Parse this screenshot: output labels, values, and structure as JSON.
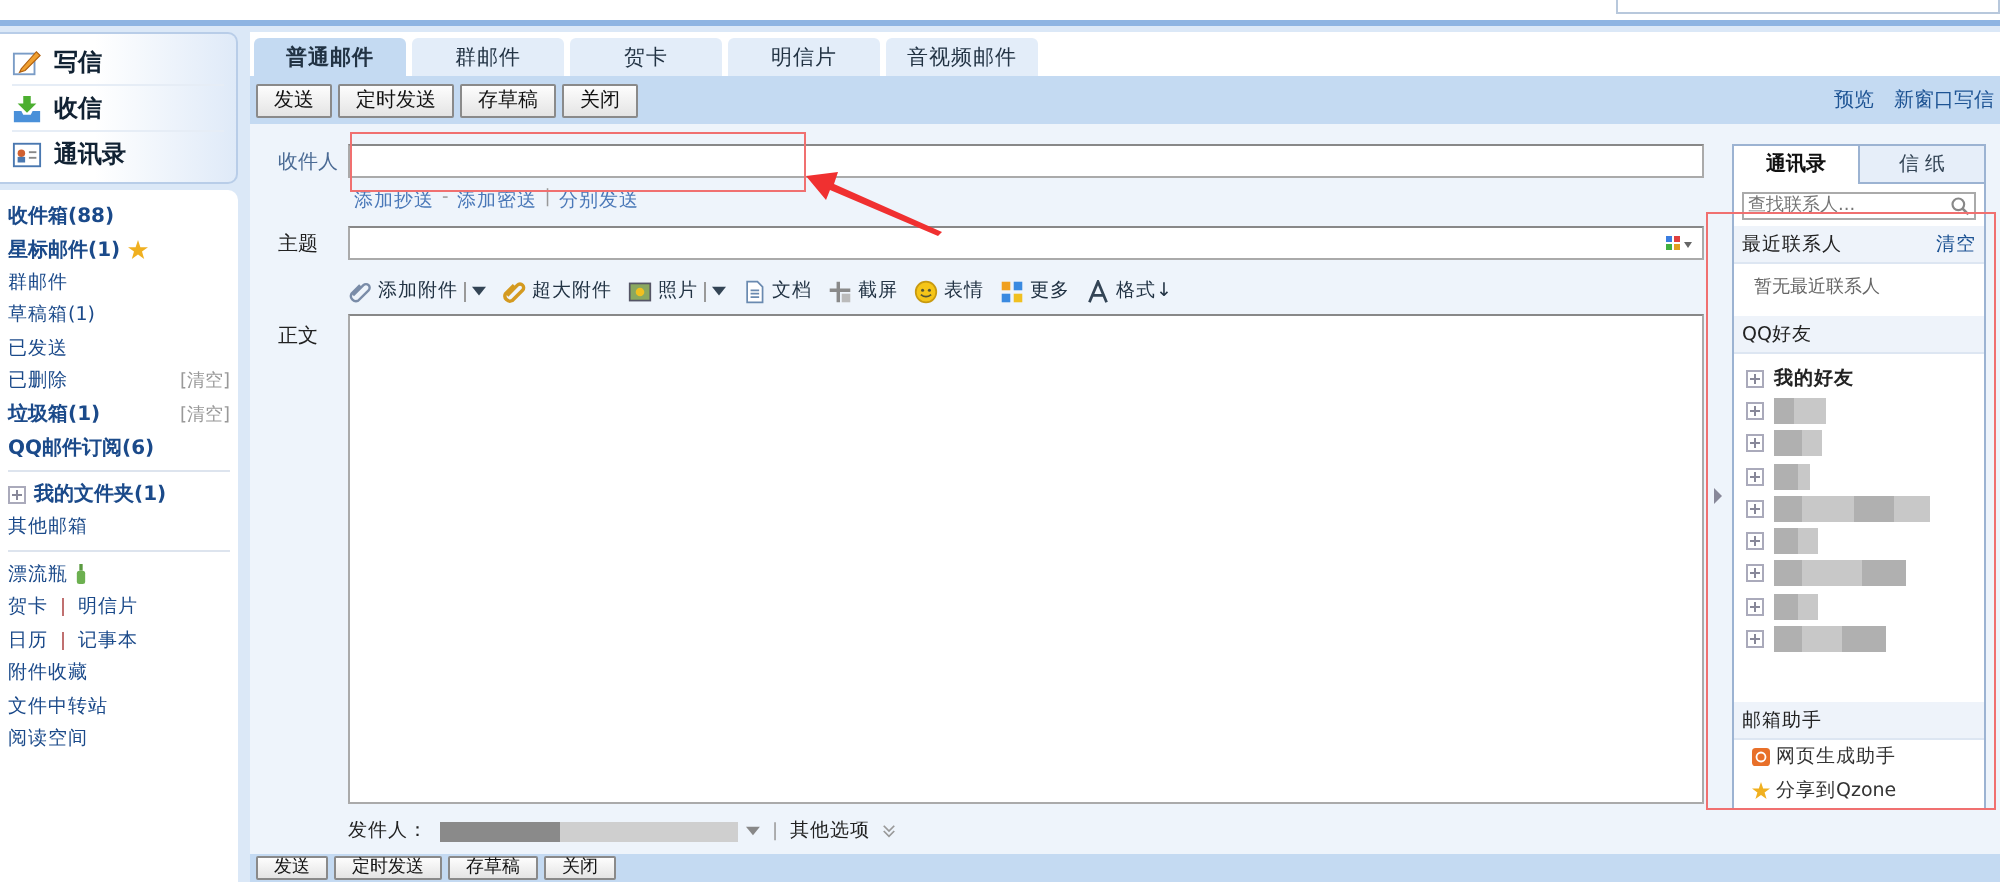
{
  "sidebar": {
    "actions": [
      {
        "kind": "write",
        "label": "写信"
      },
      {
        "kind": "receive",
        "label": "收信"
      },
      {
        "kind": "contacts",
        "label": "通讯录"
      }
    ],
    "groups": [
      [
        {
          "label": "收件箱(88)",
          "bold": true,
          "starred": false
        },
        {
          "label": "星标邮件(1)",
          "bold": true,
          "starred": true
        },
        {
          "label": "群邮件",
          "bold": false,
          "starred": false
        },
        {
          "label": "草稿箱(1)",
          "bold": false,
          "starred": false
        },
        {
          "label": "已发送",
          "bold": false,
          "starred": false
        },
        {
          "label": "已删除",
          "bold": false,
          "starred": false,
          "action": "[清空]"
        },
        {
          "label": "垃圾箱(1)",
          "bold": true,
          "starred": false,
          "action": "[清空]"
        },
        {
          "label": "QQ邮件订阅(6)",
          "bold": true,
          "starred": false
        }
      ],
      [
        {
          "label": "我的文件夹(1)",
          "bold": true,
          "starred": false,
          "expandable": true
        },
        {
          "label": "其他邮箱",
          "bold": false,
          "starred": false
        }
      ]
    ],
    "apps": [
      [
        {
          "label": "漂流瓶",
          "bottle": true
        }
      ],
      [
        {
          "label": "贺卡"
        },
        {
          "label": "明信片"
        }
      ],
      [
        {
          "label": "日历"
        },
        {
          "label": "记事本"
        }
      ],
      [
        {
          "label": "附件收藏"
        }
      ],
      [
        {
          "label": "文件中转站"
        }
      ],
      [
        {
          "label": "阅读空间"
        }
      ]
    ]
  },
  "tabs": [
    {
      "label": "普通邮件",
      "selected": true
    },
    {
      "label": "群邮件",
      "selected": false
    },
    {
      "label": "贺卡",
      "selected": false
    },
    {
      "label": "明信片",
      "selected": false
    },
    {
      "label": "音视频邮件",
      "selected": false
    }
  ],
  "toolbar": {
    "buttons": [
      "发送",
      "定时发送",
      "存草稿",
      "关闭"
    ],
    "links": [
      "预览",
      "新窗口写信"
    ]
  },
  "form": {
    "recipient_label": "收件人",
    "recipient_links": [
      {
        "label": "添加抄送"
      },
      {
        "label": "添加密送",
        "separator": "-"
      },
      {
        "label": "分别发送",
        "separator": "|"
      }
    ],
    "subject_label": "主题",
    "attach_tools": [
      {
        "kind": "paperclip",
        "label": "添加附件",
        "dropdown": true
      },
      {
        "kind": "bigclip",
        "label": "超大附件",
        "dropdown": false
      },
      {
        "kind": "photo",
        "label": "照片",
        "dropdown": true
      },
      {
        "kind": "doc",
        "label": "文档",
        "dropdown": false
      },
      {
        "kind": "screenshot",
        "label": "截屏",
        "dropdown": false
      },
      {
        "kind": "smiley",
        "label": "表情",
        "dropdown": false
      },
      {
        "kind": "grid",
        "label": "更多",
        "dropdown": false
      },
      {
        "kind": "font",
        "label": "格式↓",
        "dropdown": false
      }
    ],
    "body_label": "正文",
    "sender_label": "发件人：",
    "separator": "|",
    "other_options": "其他选项"
  },
  "bottom_toolbar": {
    "buttons": [
      "发送",
      "定时发送",
      "存草稿",
      "关闭"
    ]
  },
  "contacts": {
    "tabs": [
      {
        "label": "通讯录",
        "selected": true
      },
      {
        "label": "信 纸",
        "selected": false
      }
    ],
    "search": {
      "placeholder": "查找联系人..."
    },
    "recent": {
      "title": "最近联系人",
      "action": "清空",
      "empty": "暂无最近联系人"
    },
    "qq": {
      "title": "QQ好友",
      "groups": [
        {
          "kind": "named",
          "label": "我的好友"
        },
        {
          "kind": "blurred"
        },
        {
          "kind": "blurred"
        },
        {
          "kind": "blurred"
        },
        {
          "kind": "blurred"
        },
        {
          "kind": "blurred"
        },
        {
          "kind": "blurred"
        },
        {
          "kind": "blurred"
        },
        {
          "kind": "blurred"
        }
      ]
    },
    "assistant": {
      "title": "邮箱助手",
      "items": [
        {
          "kind": "web",
          "label": "网页生成助手"
        },
        {
          "kind": "star",
          "label": "分享到Qzone"
        }
      ]
    }
  }
}
